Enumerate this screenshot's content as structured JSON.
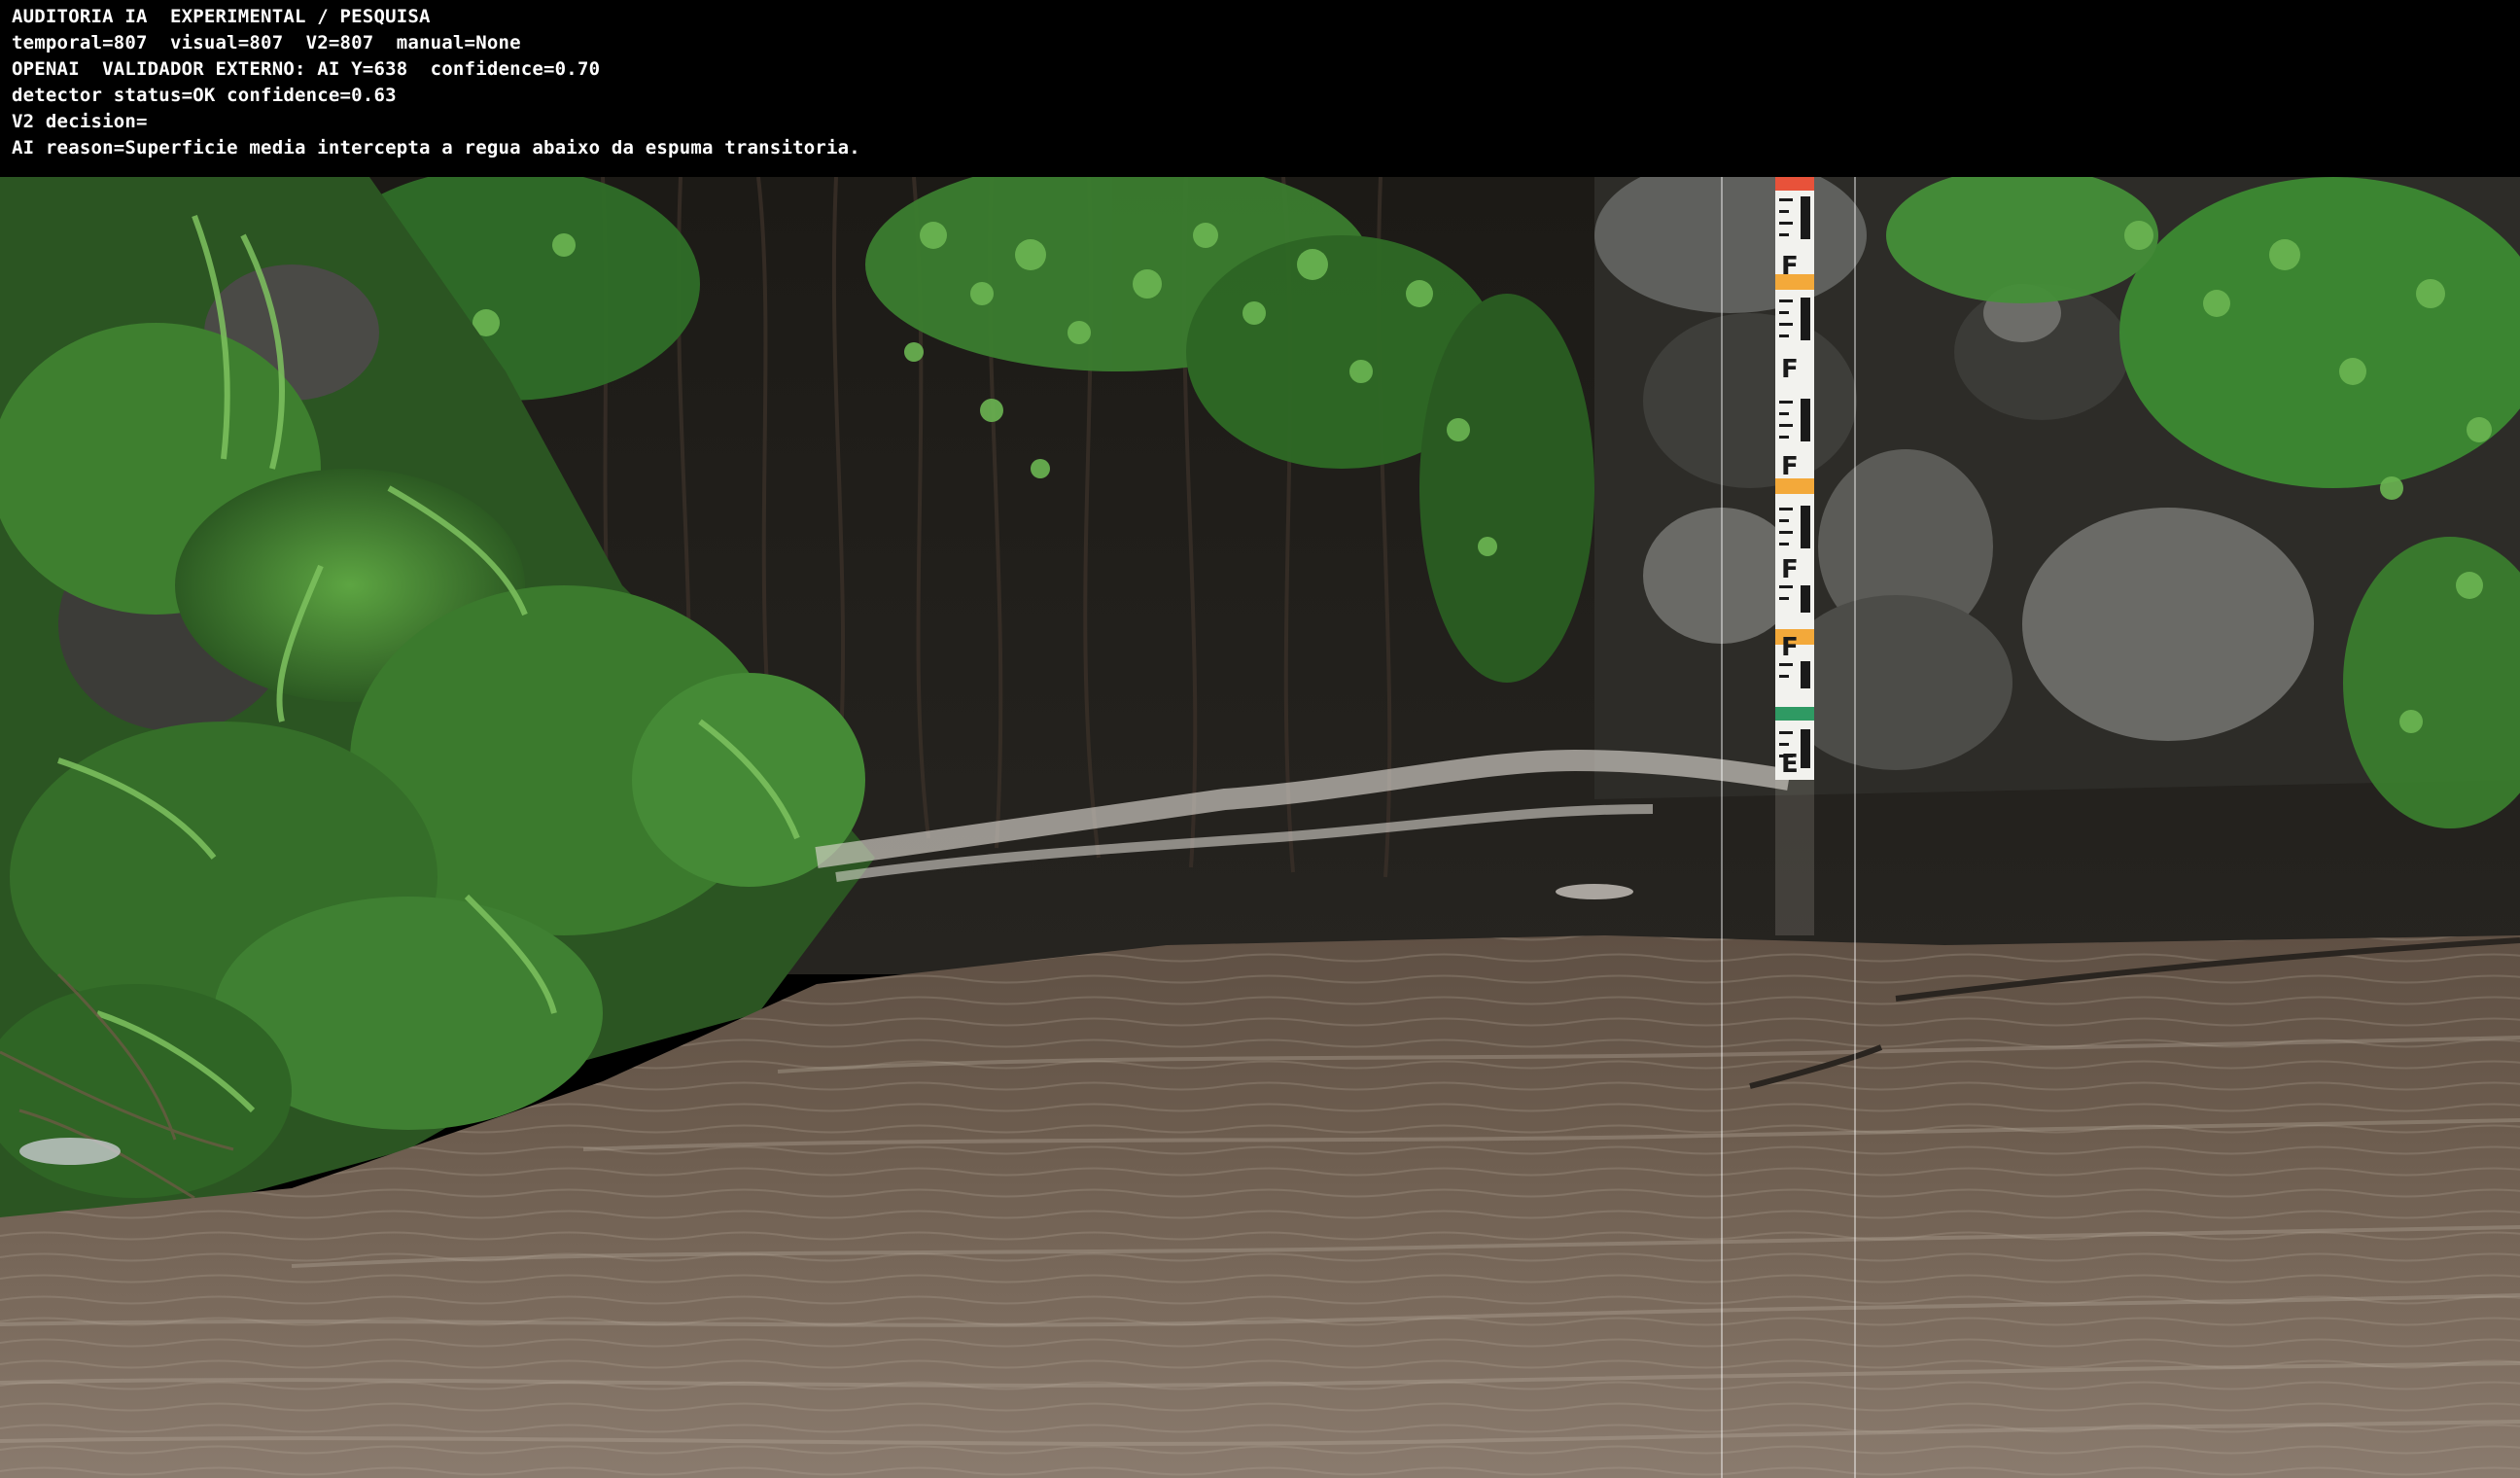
{
  "overlay": {
    "lines": [
      "AUDITORIA IA  EXPERIMENTAL / PESQUISA",
      "temporal=807  visual=807  V2=807  manual=None",
      "OPENAI  VALIDADOR EXTERNO: AI Y=638  confidence=0.70",
      "detector status=OK confidence=0.63",
      "V2 decision=",
      "AI reason=Superficie media intercepta a regua abaixo da espuma transitoria."
    ]
  },
  "scene": {
    "gauge_label_glyph": "F",
    "gauge_bottom_glyph": "E",
    "colors": {
      "water": "#6e5e4f",
      "foliage": "#3d7a2e",
      "rock": "#5a5a58",
      "gauge_white": "#f2f2ee",
      "gauge_orange": "#f3a93a",
      "gauge_red": "#e8523a",
      "gauge_green": "#2f9a63"
    }
  }
}
